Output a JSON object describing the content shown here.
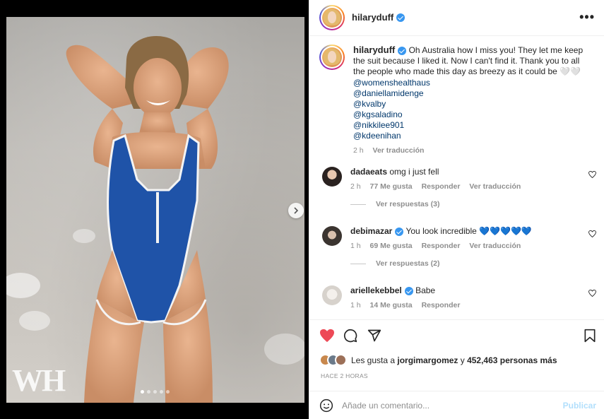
{
  "post": {
    "username": "hilaryduff",
    "caption_text": "Oh Australia how I miss you! They let me keep the suit because I liked it. Now I can't find it. Thank you to all the people who made this day as breezy as it could be 🤍🤍",
    "mentions": [
      "@womenshealthaus",
      "@daniellamidenge",
      "@kvalby",
      "@kgsaladino",
      "@nikkilee901",
      "@kdeenihan"
    ],
    "caption_time": "2 h",
    "caption_translate": "Ver traducción",
    "media_watermark": "WH",
    "carousel_count": 5,
    "carousel_active": 0
  },
  "comments": [
    {
      "user": "dadaeats",
      "text": "omg i just fell",
      "verified": false,
      "time": "2 h",
      "likes": "77 Me gusta",
      "reply": "Responder",
      "translate": "Ver traducción",
      "replies": "Ver respuestas (3)"
    },
    {
      "user": "debimazar",
      "text": "You look incredible 💙💙💙💙💙",
      "verified": true,
      "time": "1 h",
      "likes": "69 Me gusta",
      "reply": "Responder",
      "translate": "Ver traducción",
      "replies": "Ver respuestas (2)"
    },
    {
      "user": "ariellekebbel",
      "text": "Babe",
      "verified": true,
      "time": "1 h",
      "likes": "14 Me gusta",
      "reply": "Responder"
    }
  ],
  "likes": {
    "prefix": "Les gusta a ",
    "user": "jorgimargomez",
    "middle": " y ",
    "count": "452,463 personas más"
  },
  "post_time": "HACE 2 HORAS",
  "add_comment": {
    "placeholder": "Añade un comentario...",
    "publish": "Publicar"
  },
  "colors": {
    "like_red": "#ed4956",
    "verified_blue": "#3897f0",
    "publish_disabled": "#b2dffc",
    "swimsuit_blue": "#1f53a8"
  }
}
